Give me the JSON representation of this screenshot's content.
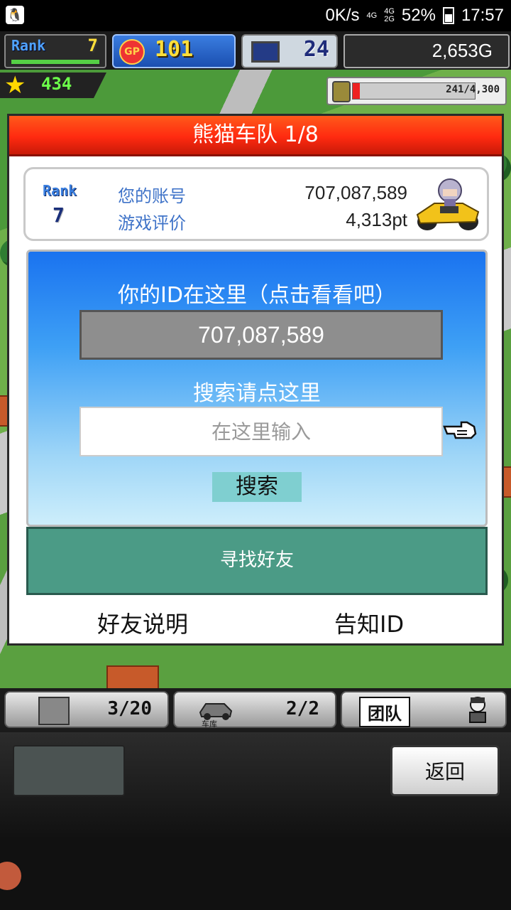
{
  "status_bar": {
    "speed": "0K/s",
    "network_4g_a": "4G",
    "network_4g_b": "4G",
    "network_2g": "2G",
    "battery": "52%",
    "time": "17:57"
  },
  "hud": {
    "rank_label": "Rank",
    "rank_value": "7",
    "gp_icon": "GP",
    "gp_value": "101",
    "pc_value": "24",
    "gold": "2,653G",
    "stars": "434",
    "fuel": "241/4,300",
    "fuel_fraction": 0.056
  },
  "dialog": {
    "title": "熊猫车队 1/8",
    "account": {
      "rank_label": "Rank",
      "rank_value": "7",
      "account_label": "您的账号",
      "account_value": "707,087,589",
      "rating_label": "游戏评价",
      "rating_value": "4,313pt"
    },
    "id_heading": "你的ID在这里（点击看看吧）",
    "id_value": "707,087,589",
    "search_heading": "搜索请点这里",
    "search_placeholder": "在这里输入",
    "search_button": "搜索",
    "find_friends": "寻找好友",
    "friend_help": "好友说明",
    "share_id": "告知ID"
  },
  "tabs": {
    "items_count": "3/20",
    "garage_count": "2/2",
    "garage_label": "车库",
    "team_label": "团队"
  },
  "bottom": {
    "back_button": "返回"
  },
  "colors": {
    "title_red": "#ff2a10",
    "panel_blue": "#1a73f0",
    "find_button": "#4b9b86",
    "search_button": "#7fcfd0"
  }
}
